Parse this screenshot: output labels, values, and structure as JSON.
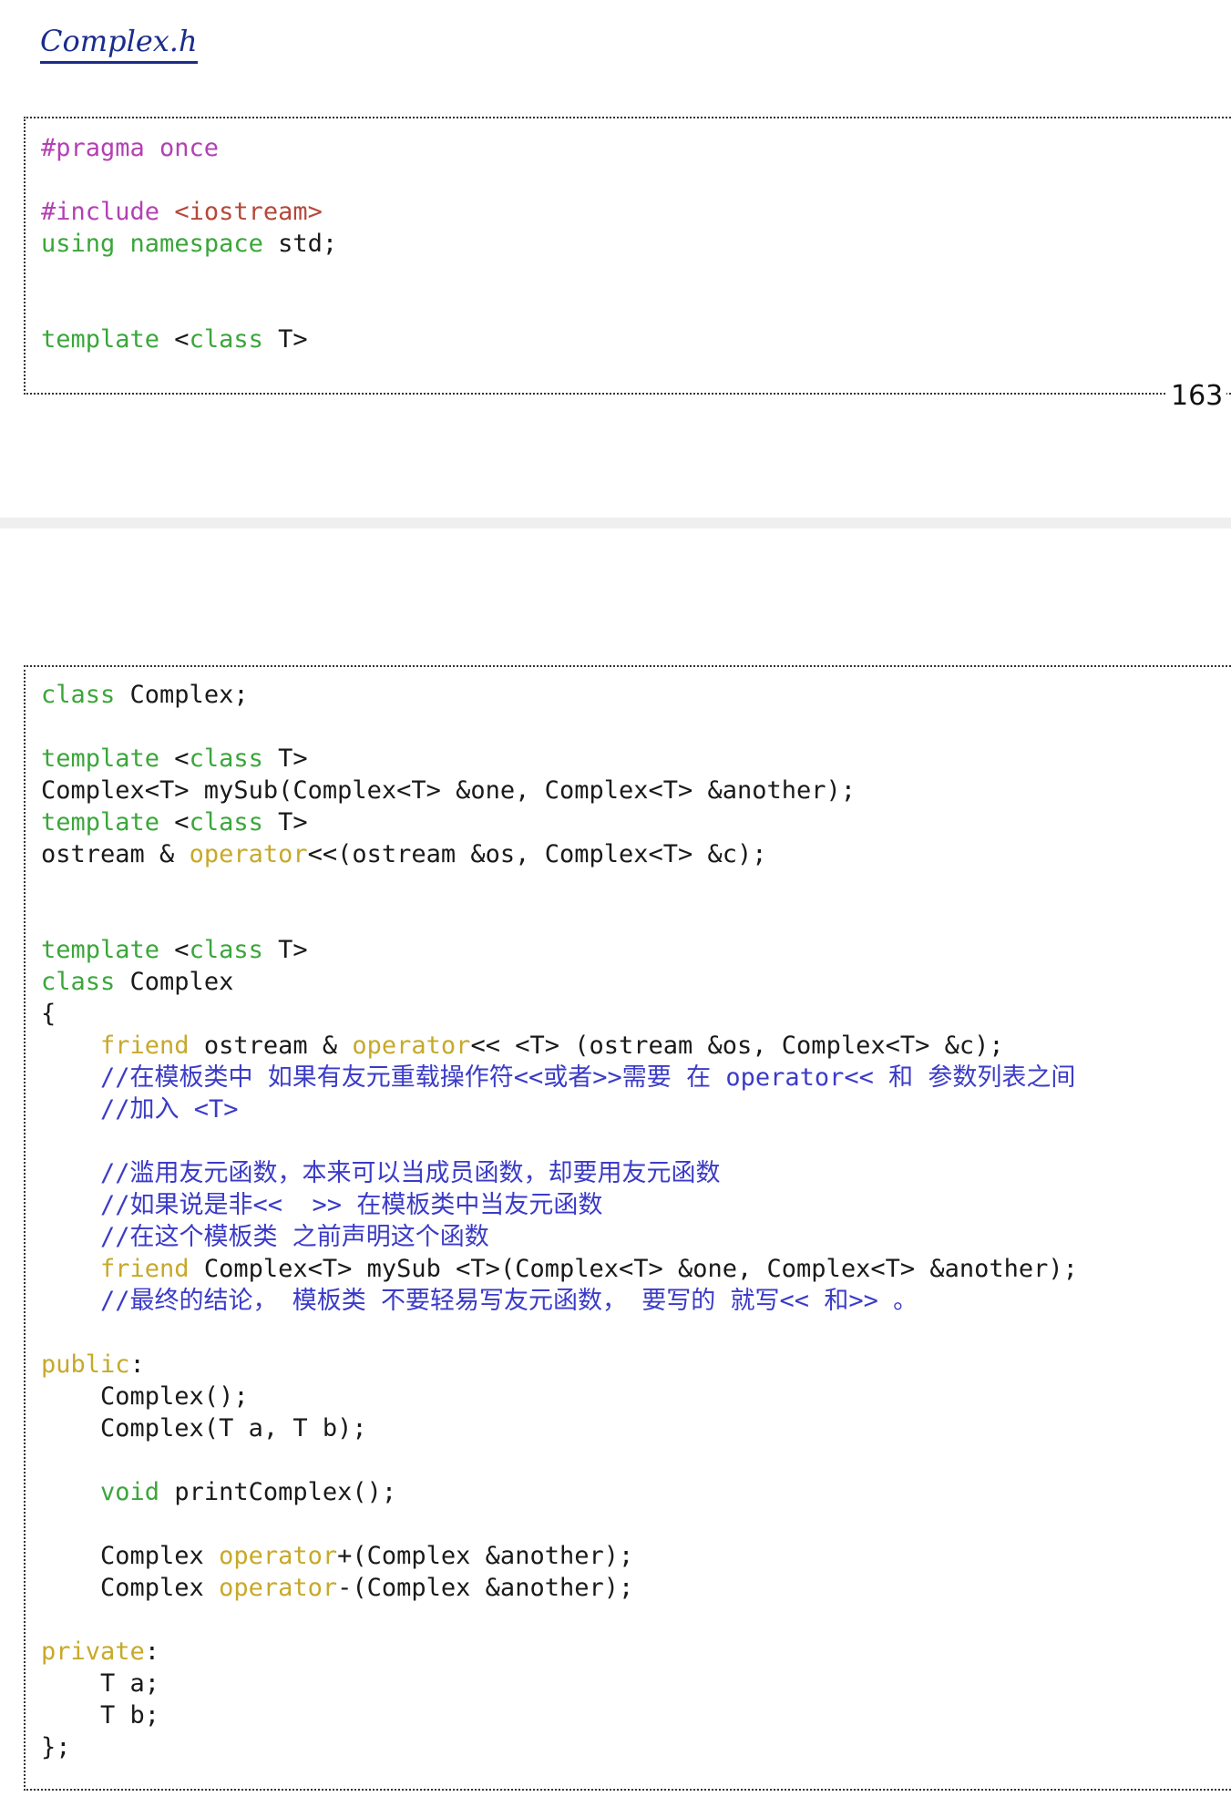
{
  "header": {
    "title": "Complex.h"
  },
  "page": {
    "number": "163"
  },
  "code1": {
    "l1": "#pragma once",
    "l3a": "#include ",
    "l3b": "<iostream>",
    "l4a": "using",
    "l4b": "namespace",
    "l4c": " std;",
    "l7a": "template",
    "l7b": " <",
    "l7c": "class",
    "l7d": " T>"
  },
  "code2": {
    "a1": "class",
    "a2": " Complex;",
    "b1": "template",
    "b2": " <",
    "b3": "class",
    "b4": " T>",
    "c1": "Complex<T> mySub(Complex<T> &one, Complex<T> &another);",
    "d1": "template",
    "d2": " <",
    "d3": "class",
    "d4": " T>",
    "e1": "ostream & ",
    "e2": "operator",
    "e3": "<<(ostream &os, Complex<T> &c);",
    "f1": "template",
    "f2": " <",
    "f3": "class",
    "f4": " T>",
    "g1": "class",
    "g2": " Complex",
    "h1": "{",
    "i0": "    ",
    "i1": "friend",
    "i2": " ostream & ",
    "i3": "operator",
    "i4": "<< <T> (ostream &os, Complex<T> &c);",
    "j1": "    //在模板类中 如果有友元重载操作符<<或者>>需要 在 operator<< 和 参数列表之间",
    "k1": "    //加入 <T>",
    "m1": "    //滥用友元函数，本来可以当成员函数，却要用友元函数",
    "n1": "    //如果说是非<<  >> 在模板类中当友元函数",
    "o1": "    //在这个模板类 之前声明这个函数",
    "p0": "    ",
    "p1": "friend",
    "p2": " Complex<T> mySub <T>(Complex<T> &one, Complex<T> &another);",
    "q1": "    //最终的结论， 模板类 不要轻易写友元函数， 要写的 就写<< 和>> 。",
    "s1": "public",
    "s2": ":",
    "t1": "    Complex();",
    "u1": "    Complex(T a, T b);",
    "w0": "    ",
    "w1": "void",
    "w2": " printComplex();",
    "y0": "    Complex ",
    "y1": "operator",
    "y2": "+(Complex &another);",
    "z0": "    Complex ",
    "z1": "operator",
    "z2": "-(Complex &another);",
    "pr1": "private",
    "pr2": ":",
    "ta": "    T a;",
    "tb": "    T b;",
    "end": "};"
  }
}
